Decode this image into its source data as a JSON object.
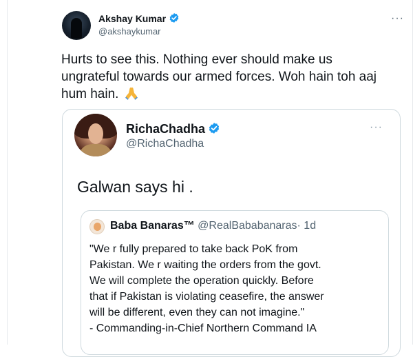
{
  "tweet": {
    "author": {
      "name": "Akshay Kumar",
      "handle": "@akshaykumar",
      "verified": true
    },
    "more_label": "···",
    "text": "Hurts to see this. Nothing ever should make us ungrateful towards our armed forces. Woh hain toh aaj hum hain.",
    "emoji_icon": "folded-hands-icon"
  },
  "quoted_tweet": {
    "author": {
      "name": "RichaChadha",
      "handle": "@RichaChadha",
      "verified": true
    },
    "more_label": "···",
    "text": "Galwan says hi ."
  },
  "nested_quote": {
    "author": {
      "name": "Baba Banaras™",
      "handle": "@RealBababanaras",
      "time": "· 1d"
    },
    "lines": [
      "\"We r fully prepared to take back PoK from",
      "Pakistan. We r waiting the orders from the govt.",
      "We will complete the operation quickly. Before",
      "that if Pakistan is violating ceasefire, the answer",
      "will be different, even they can not imagine.\"",
      "- Commanding-in-Chief Northern Command IA"
    ]
  },
  "colors": {
    "verified_blue": "#1d9bf0",
    "secondary_text": "#536471",
    "border": "#cfd9de"
  }
}
